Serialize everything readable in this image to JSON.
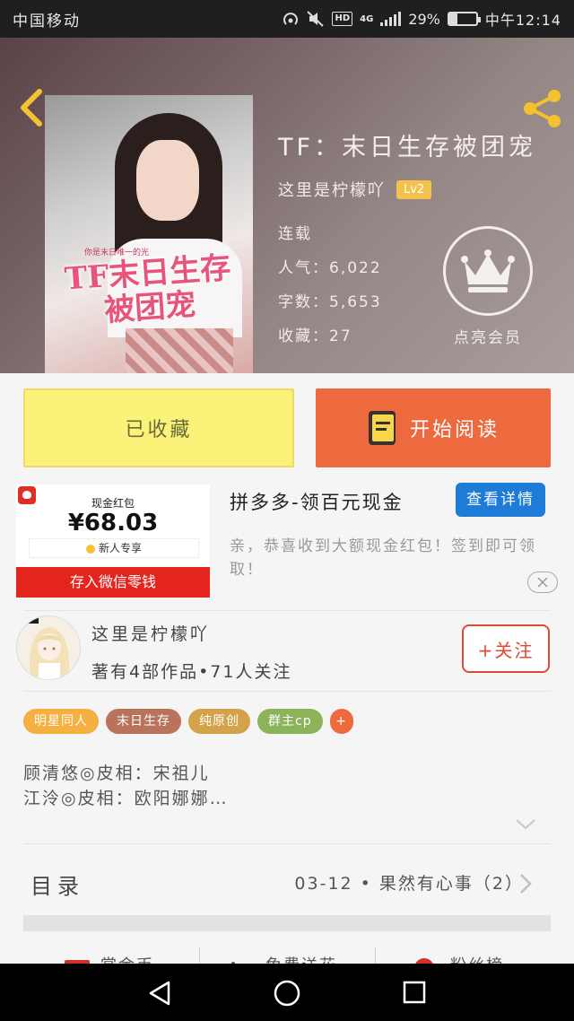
{
  "status_bar": {
    "carrier": "中国移动",
    "hd": "HD",
    "network": "4G",
    "battery": "29%",
    "battery_level": 0.29,
    "time": "中午12:14"
  },
  "header": {
    "back_icon": "chevron-left-icon",
    "share_icon": "share-icon",
    "accent_color": "#f5c12e"
  },
  "book": {
    "cover_title": "TF末日生存被团宠",
    "cover_subtitle": "你是末日唯一的光",
    "title": "TF：末日生存被团宠",
    "author": "这里是柠檬吖",
    "level": "Lv2",
    "status": "连载",
    "popularity": "人气：6,022",
    "word_count": "字数：5,653",
    "favorites": "收藏：27",
    "vip_label": "点亮会员"
  },
  "actions": {
    "favorite_label": "已收藏",
    "read_label": "开始阅读",
    "favorite_color": "#fbf27a",
    "read_color": "#ec6a3e"
  },
  "ad": {
    "label": "现金红包",
    "amount": "¥68.03",
    "new_user": "新人专享",
    "cta": "存入微信零钱",
    "title": "拼多多-领百元现金",
    "detail_button": "查看详情",
    "description": "亲，恭喜收到大额现金红包！签到即可领取！"
  },
  "author_card": {
    "name": "这里是柠檬吖",
    "stats": "著有4部作品•71人关注",
    "follow_label": "+关注"
  },
  "tags": [
    {
      "label": "明星同人",
      "color": "#f5b041"
    },
    {
      "label": "末日生存",
      "color": "#b9735a"
    },
    {
      "label": "纯原创",
      "color": "#d4a24a"
    },
    {
      "label": "群主cp",
      "color": "#8db35a"
    }
  ],
  "tag_add": "+",
  "intro": {
    "line1": "顾清悠◎皮相：宋祖儿",
    "line2": "江泠◎皮相：欧阳娜娜…"
  },
  "toc": {
    "title": "目录",
    "latest": "03-12 • 果然有心事（2）"
  },
  "bottom_actions": [
    "赏金币",
    "免费送花",
    "粉丝榜"
  ]
}
